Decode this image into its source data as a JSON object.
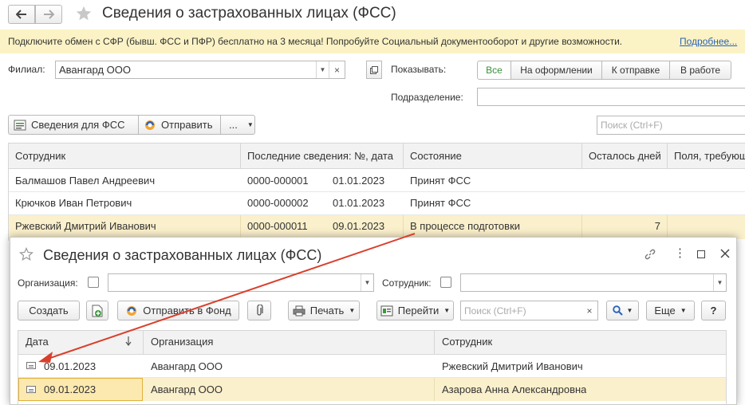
{
  "main": {
    "title": "Сведения о застрахованных лицах (ФСС)",
    "banner": {
      "text": "Подключите обмен с СФР (бывш. ФСС и ПФР) бесплатно на 3 месяца! Попробуйте Социальный документооборот и другие возможности.",
      "link": "Подробнее..."
    },
    "filial_label": "Филиал:",
    "filial_value": "Авангард ООО",
    "show_label": "Показывать:",
    "show_options": [
      "Все",
      "На оформлении",
      "К отправке",
      "В работе"
    ],
    "subdivision_label": "Подразделение:",
    "toolbar": {
      "info_button": "Сведения для ФСС",
      "send_button": "Отправить",
      "more_button": "...",
      "search_placeholder": "Поиск (Ctrl+F)"
    },
    "table": {
      "columns": [
        "Сотрудник",
        "Последние сведения: №, дата",
        "Состояние",
        "Осталось дней",
        "Поля, требующ"
      ],
      "rows": [
        {
          "employee": "Балмашов Павел Андреевич",
          "number": "0000-000001",
          "date": "01.01.2023",
          "state": "Принят ФСС",
          "days": ""
        },
        {
          "employee": "Крючков Иван Петрович",
          "number": "0000-000002",
          "date": "01.01.2023",
          "state": "Принят ФСС",
          "days": ""
        },
        {
          "employee": "Ржевский Дмитрий Иванович",
          "number": "0000-000011",
          "date": "09.01.2023",
          "state": "В процессе подготовки",
          "days": "7"
        }
      ]
    }
  },
  "popup": {
    "title": "Сведения о застрахованных лицах (ФСС)",
    "org_label": "Организация:",
    "employee_label": "Сотрудник:",
    "toolbar": {
      "create": "Создать",
      "send_fund": "Отправить в Фонд",
      "print": "Печать",
      "goto": "Перейти",
      "search_placeholder": "Поиск (Ctrl+F)",
      "more": "Еще",
      "help": "?"
    },
    "table": {
      "columns": [
        "Дата",
        "Организация",
        "Сотрудник"
      ],
      "rows": [
        {
          "date": "09.01.2023",
          "org": "Авангард ООО",
          "employee": "Ржевский Дмитрий Иванович"
        },
        {
          "date": "09.01.2023",
          "org": "Авангард ООО",
          "employee": "Азарова Анна Александровна"
        }
      ]
    }
  },
  "colors": {
    "banner_bg": "#fbf3c5",
    "selected_row": "#fbf0cc",
    "active_tab": "#3a8f3a",
    "link": "#2a62b8",
    "arrow": "#d9402c"
  }
}
